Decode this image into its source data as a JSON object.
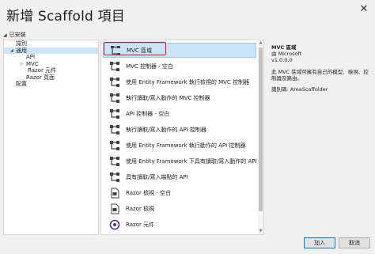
{
  "window": {
    "title": "新增 Scaffold 項目",
    "close_label": "✕"
  },
  "tree": {
    "root_label": "已安裝",
    "items": [
      {
        "label": "識別",
        "level": 0
      },
      {
        "label": "通用",
        "level": 0,
        "expanded": true,
        "selected": true
      },
      {
        "label": "API",
        "level": 1
      },
      {
        "label": "MVC",
        "level": 1,
        "expandable": true
      },
      {
        "label": "Razor 元件",
        "level": 1
      },
      {
        "label": "Razor 頁面",
        "level": 1
      },
      {
        "label": "配置",
        "level": 0
      }
    ]
  },
  "templates": [
    {
      "label": "MVC 區域",
      "icon": "mvc-area-icon",
      "selected": true
    },
    {
      "label": "MVC 控制器 - 空白",
      "icon": "controller-icon"
    },
    {
      "label": "使用 Entity Framework 執行檢視的 MVC 控制器",
      "icon": "controller-icon"
    },
    {
      "label": "執行讀取/寫入動作的 MVC 控制器",
      "icon": "controller-icon"
    },
    {
      "label": "API 控制器 - 空白",
      "icon": "controller-icon"
    },
    {
      "label": "執行讀取/寫入動作的 API 控制器",
      "icon": "controller-icon"
    },
    {
      "label": "使用 Entity Framework 執行動作的 API 控制器",
      "icon": "controller-icon"
    },
    {
      "label": "使用 Entity Framework 下具有讀取/寫入動作的 API 控制器",
      "icon": "controller-icon"
    },
    {
      "label": "具有讀取/寫入端點的 API",
      "icon": "controller-icon"
    },
    {
      "label": "Razor 檢視 - 空白",
      "icon": "razor-view-icon"
    },
    {
      "label": "Razor 檢視",
      "icon": "razor-view-icon"
    },
    {
      "label": "Razor 元件",
      "icon": "razor-component-icon"
    }
  ],
  "details": {
    "name": "MVC 區域",
    "author": "由 Microsoft",
    "version": "v1.0.0.0",
    "description": "此 MVC 區域可擁有自己的模型、檢視、控制器及路由。",
    "id_text": "識別碼: AreaScaffolder"
  },
  "buttons": {
    "add": "加入",
    "cancel": "取消"
  },
  "colors": {
    "selection": "#cce4f7",
    "highlight_box": "#e81123",
    "accent": "#0078d7"
  }
}
